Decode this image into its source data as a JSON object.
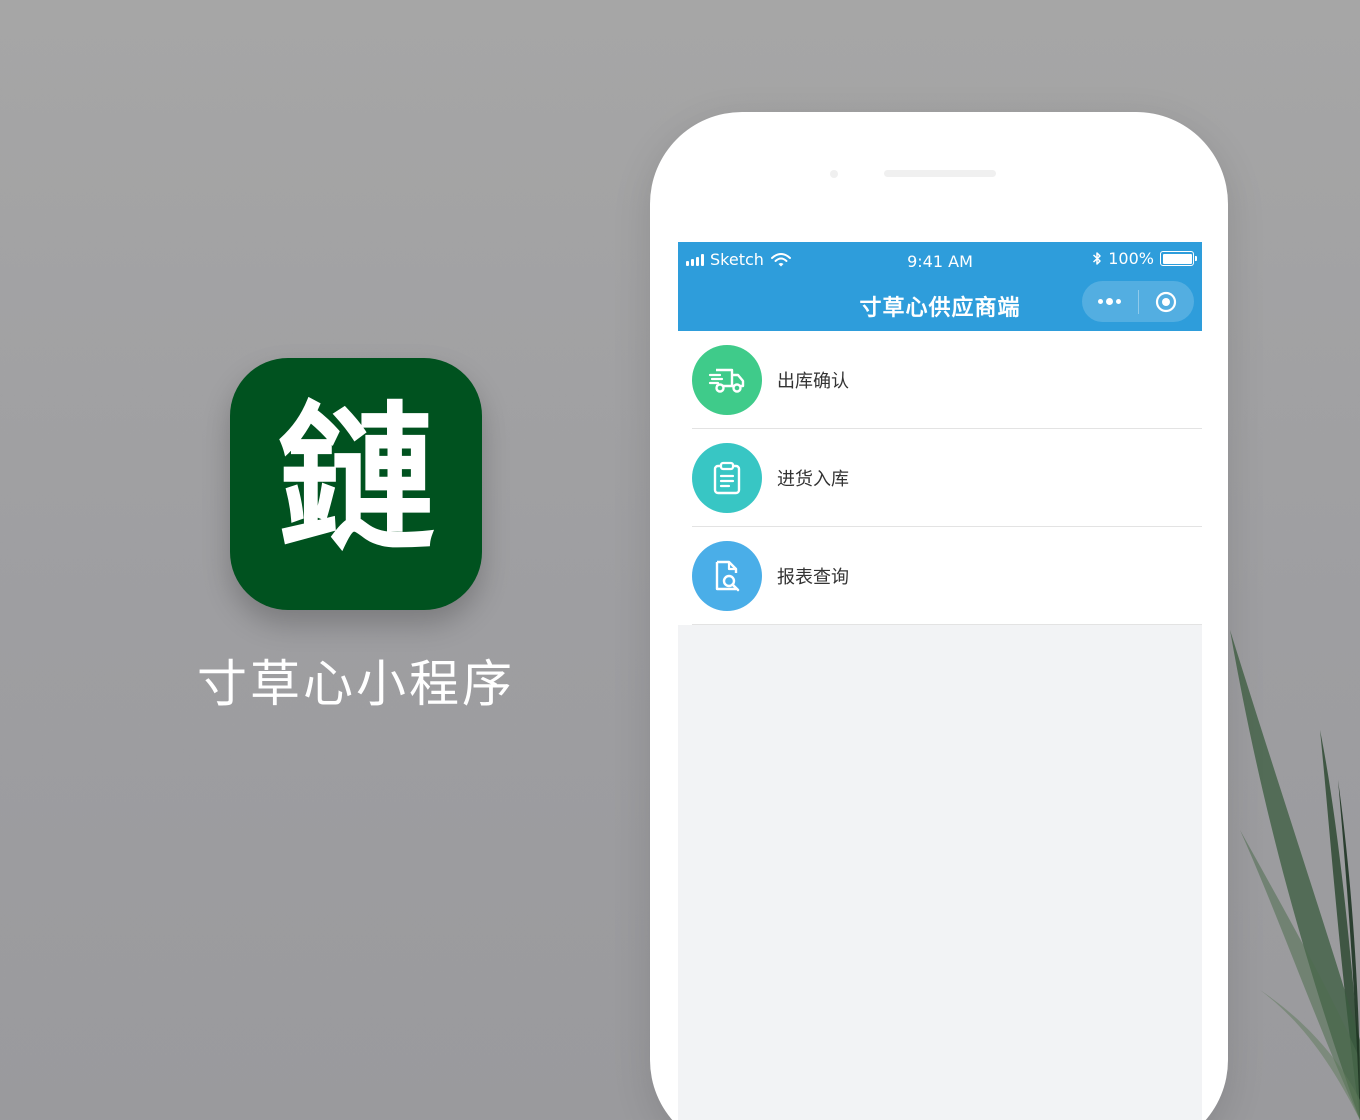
{
  "app": {
    "icon_glyph": "鏈",
    "name": "寸草心小程序",
    "icon_color": "#00521f"
  },
  "status_bar": {
    "carrier": "Sketch",
    "time": "9:41 AM",
    "battery": "100%"
  },
  "nav": {
    "title": "寸草心供应商端",
    "color": "#2e9ddb",
    "capsule": [
      "more-icon",
      "close-target-icon"
    ]
  },
  "menu": {
    "items": [
      {
        "label": "出库确认",
        "icon": "delivery-truck-icon",
        "color": "#3fcb8a"
      },
      {
        "label": "进货入库",
        "icon": "clipboard-icon",
        "color": "#38c6c4"
      },
      {
        "label": "报表查询",
        "icon": "document-search-icon",
        "color": "#4aaee8"
      }
    ]
  }
}
